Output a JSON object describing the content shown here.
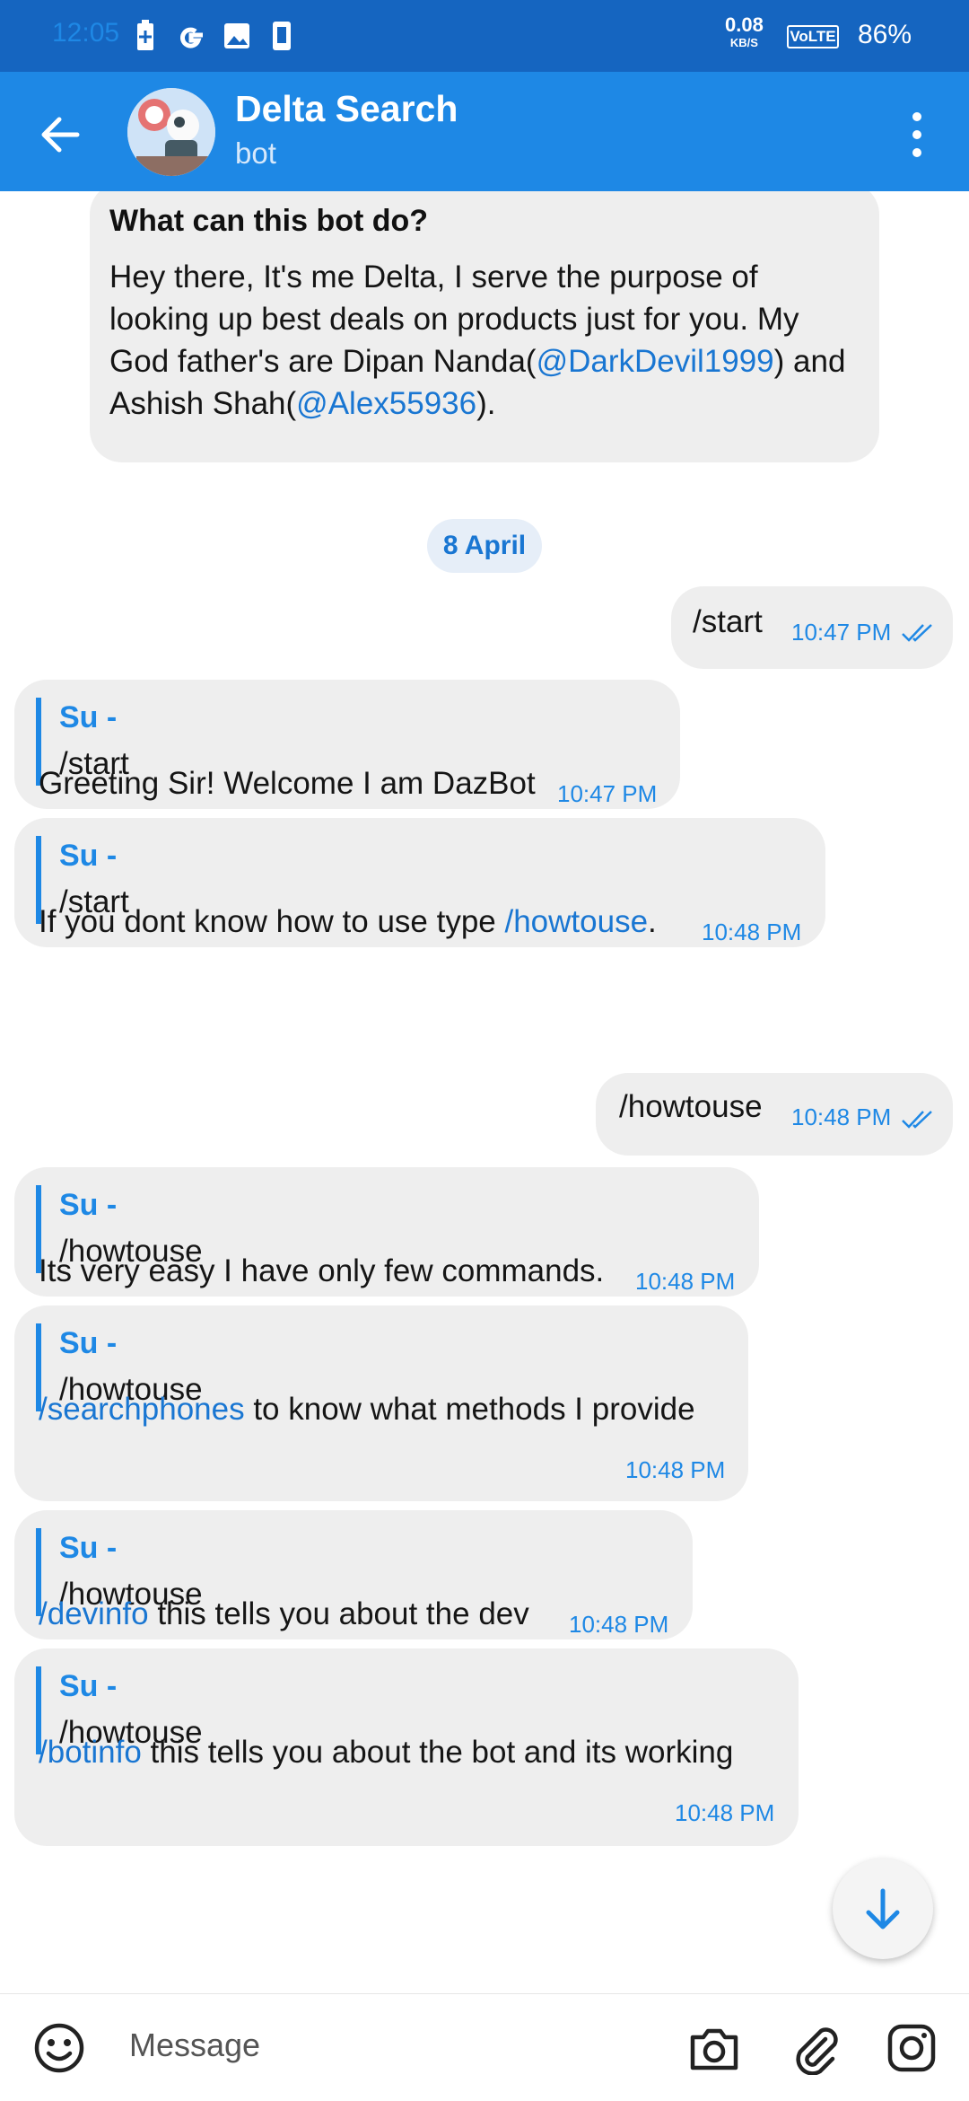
{
  "status_bar": {
    "time": "12:05",
    "speed": "0.08",
    "speed_unit": "KB/S",
    "network": "VoLTE",
    "battery": "86%"
  },
  "header": {
    "title": "Delta Search",
    "subtitle": "bot"
  },
  "intro": {
    "title": "What can this bot do?",
    "line1": "Hey there, It's me Delta, I serve the purpose of",
    "line2": "looking up best deals on products just for you. My",
    "line3_pre": "God father's are Dipan Nanda(",
    "line3_link": "@DarkDevil1999",
    "line3_post": ") and",
    "line4_pre": "Ashish Shah(",
    "line4_link": "@Alex55936",
    "line4_post": ")."
  },
  "date_separator": "8 April",
  "messages": [
    {
      "text": "/start",
      "time": "10:47 PM"
    },
    {
      "reply_name": "Su -",
      "reply_text": "/start",
      "text": "Greeting Sir! Welcome I am DazBot",
      "time": "10:47 PM"
    },
    {
      "reply_name": "Su -",
      "reply_text": "/start",
      "text_pre": "If you dont know how to use type ",
      "text_link": "/howtouse",
      "text_post": ".",
      "time": "10:48 PM"
    },
    {
      "text": "/howtouse",
      "time": "10:48 PM"
    },
    {
      "reply_name": "Su -",
      "reply_text": "/howtouse",
      "text": "Its very easy I have only few commands.",
      "time": "10:48 PM"
    },
    {
      "reply_name": "Su -",
      "reply_text": "/howtouse",
      "text_link": "/searchphones",
      "text_post": " to know what methods I provide",
      "time": "10:48 PM"
    },
    {
      "reply_name": "Su -",
      "reply_text": "/howtouse",
      "text_link": "/devinfo",
      "text_post": " this tells you about the dev",
      "time": "10:48 PM"
    },
    {
      "reply_name": "Su -",
      "reply_text": "/howtouse",
      "text_link": "/botinfo",
      "text_post": " this tells you about the bot and its working",
      "time": "10:48 PM"
    }
  ],
  "input": {
    "placeholder": "Message"
  },
  "colors": {
    "status_bar": "#1565c0",
    "app_bar": "#1e88e5",
    "bubble": "#eeeeee",
    "accent": "#1e88e5"
  }
}
